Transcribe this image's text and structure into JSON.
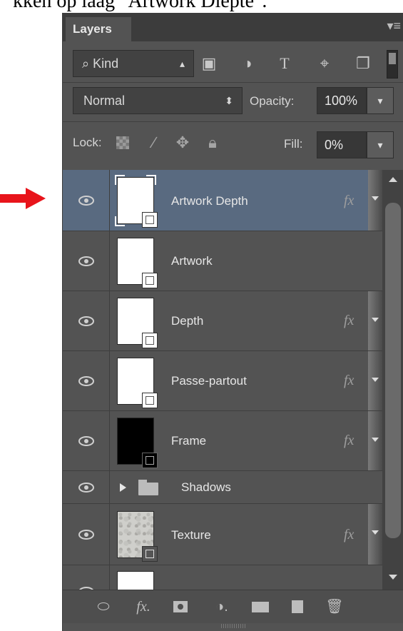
{
  "caption": "kken op laag \"Artwork Diepte\".",
  "panel": {
    "tab_label": "Layers",
    "menu_icon": "panel-menu-icon",
    "filter": {
      "kind_label": "⌕ Kind",
      "kind_spin": "♢"
    },
    "blend": {
      "mode": "Normal",
      "opacity_label": "Opacity:",
      "opacity_value": "100%"
    },
    "lock": {
      "label": "Lock:",
      "fill_label": "Fill:",
      "fill_value": "0%"
    },
    "layers": [
      {
        "name": "Artwork Depth",
        "fx": "fx",
        "selected": true
      },
      {
        "name": "Artwork",
        "fx": ""
      },
      {
        "name": "Depth",
        "fx": "fx"
      },
      {
        "name": "Passe-partout",
        "fx": "fx"
      },
      {
        "name": "Frame",
        "fx": "fx"
      },
      {
        "name": "Shadows",
        "fx": "",
        "type": "group"
      },
      {
        "name": "Texture",
        "fx": "fx"
      }
    ]
  },
  "colors": {
    "panel_bg": "#535353",
    "selected_row": "#596a80",
    "arrow": "#e8141b"
  }
}
